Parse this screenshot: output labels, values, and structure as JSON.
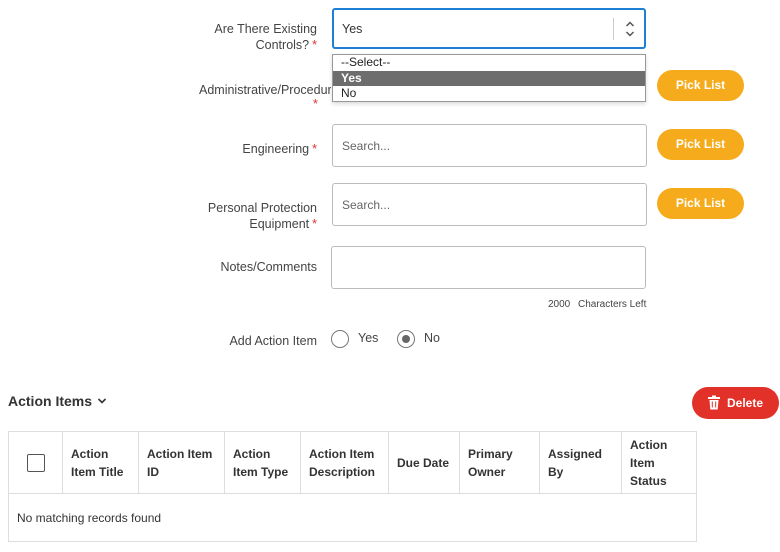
{
  "form": {
    "existing_controls": {
      "label_line1": "Are There Existing",
      "label_line2": "Controls?",
      "value": "Yes",
      "options": [
        "--Select--",
        "Yes",
        "No"
      ]
    },
    "administrative": {
      "label": "Administrative/Procedur",
      "pick_list_label": "Pick List"
    },
    "engineering": {
      "label": "Engineering",
      "placeholder": "Search...",
      "pick_list_label": "Pick List"
    },
    "ppe": {
      "label_line1": "Personal Protection",
      "label_line2": "Equipment",
      "placeholder": "Search...",
      "pick_list_label": "Pick List"
    },
    "notes": {
      "label": "Notes/Comments",
      "chars_count": "2000",
      "chars_label": "Characters Left"
    },
    "add_action_item": {
      "label": "Add Action Item",
      "yes_label": "Yes",
      "no_label": "No",
      "selected": "No"
    },
    "required_mark": "*"
  },
  "action_items": {
    "title": "Action Items",
    "delete_label": "Delete",
    "columns": [
      "Action\nItem Title",
      "Action Item\nID",
      "Action\nItem Type",
      "Action Item\nDescription",
      "Due Date",
      "Primary\nOwner",
      "Assigned\nBy",
      "Action\nItem\nStatus"
    ],
    "empty_message": "No matching records found"
  },
  "colors": {
    "pick_button": "#f5ab1b",
    "delete_button": "#e23128",
    "focus_border": "#1e7fd6",
    "required": "#e03030"
  }
}
